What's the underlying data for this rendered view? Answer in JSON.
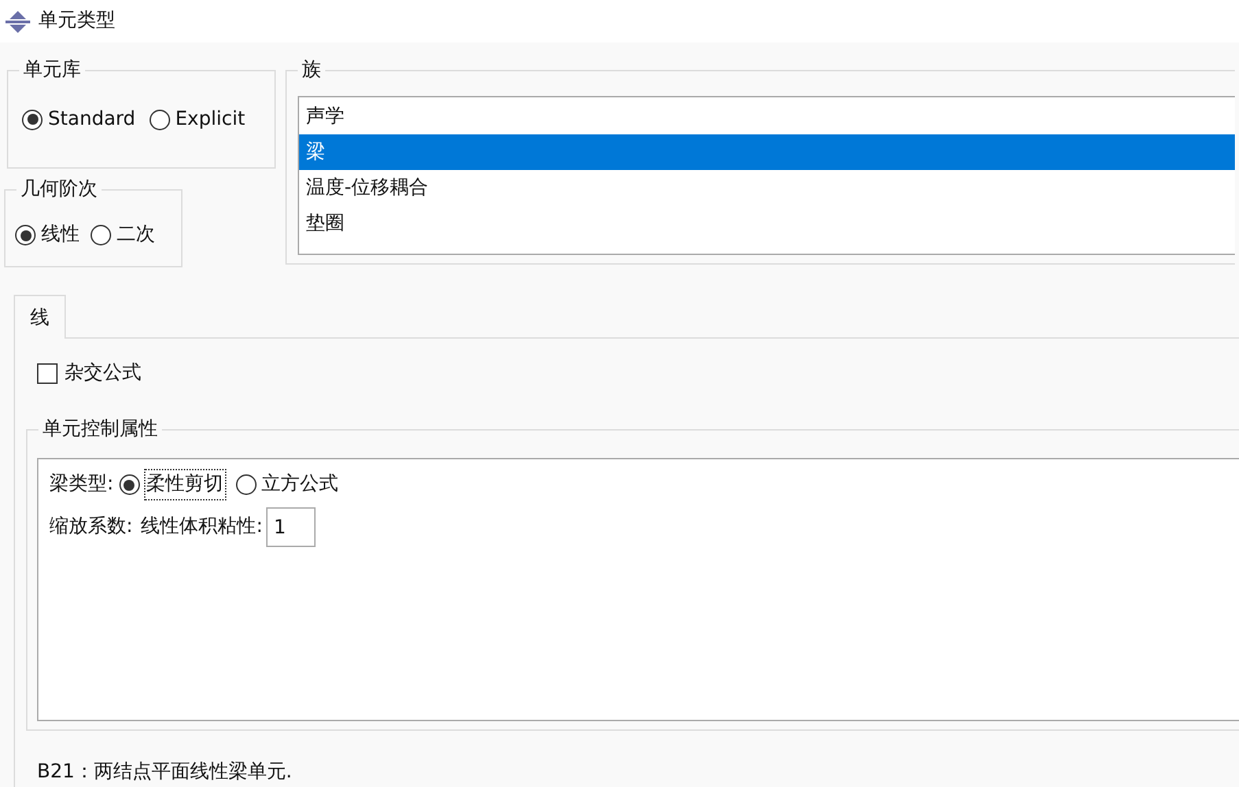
{
  "window": {
    "title": "单元类型"
  },
  "element_library": {
    "title": "单元库",
    "options": [
      {
        "label": "Standard",
        "selected": true
      },
      {
        "label": "Explicit",
        "selected": false
      }
    ]
  },
  "geometric_order": {
    "title": "几何阶次",
    "options": [
      {
        "label": "线性",
        "selected": true
      },
      {
        "label": "二次",
        "selected": false
      }
    ]
  },
  "family": {
    "title": "族",
    "items": [
      {
        "label": "声学",
        "selected": false
      },
      {
        "label": "梁",
        "selected": true
      },
      {
        "label": "温度-位移耦合",
        "selected": false
      },
      {
        "label": "垫圈",
        "selected": false
      }
    ]
  },
  "tabs": [
    {
      "label": "线",
      "selected": true
    }
  ],
  "hybrid": {
    "label": "杂交公式",
    "checked": false
  },
  "element_controls": {
    "title": "单元控制属性",
    "beam_type": {
      "label": "梁类型:",
      "options": [
        {
          "label": "柔性剪切",
          "selected": true
        },
        {
          "label": "立方公式",
          "selected": false
        }
      ]
    },
    "scaling": {
      "label": "缩放系数:",
      "field_label": "线性体积粘性:",
      "value": "1"
    }
  },
  "description": "B21：两结点平面线性梁单元."
}
